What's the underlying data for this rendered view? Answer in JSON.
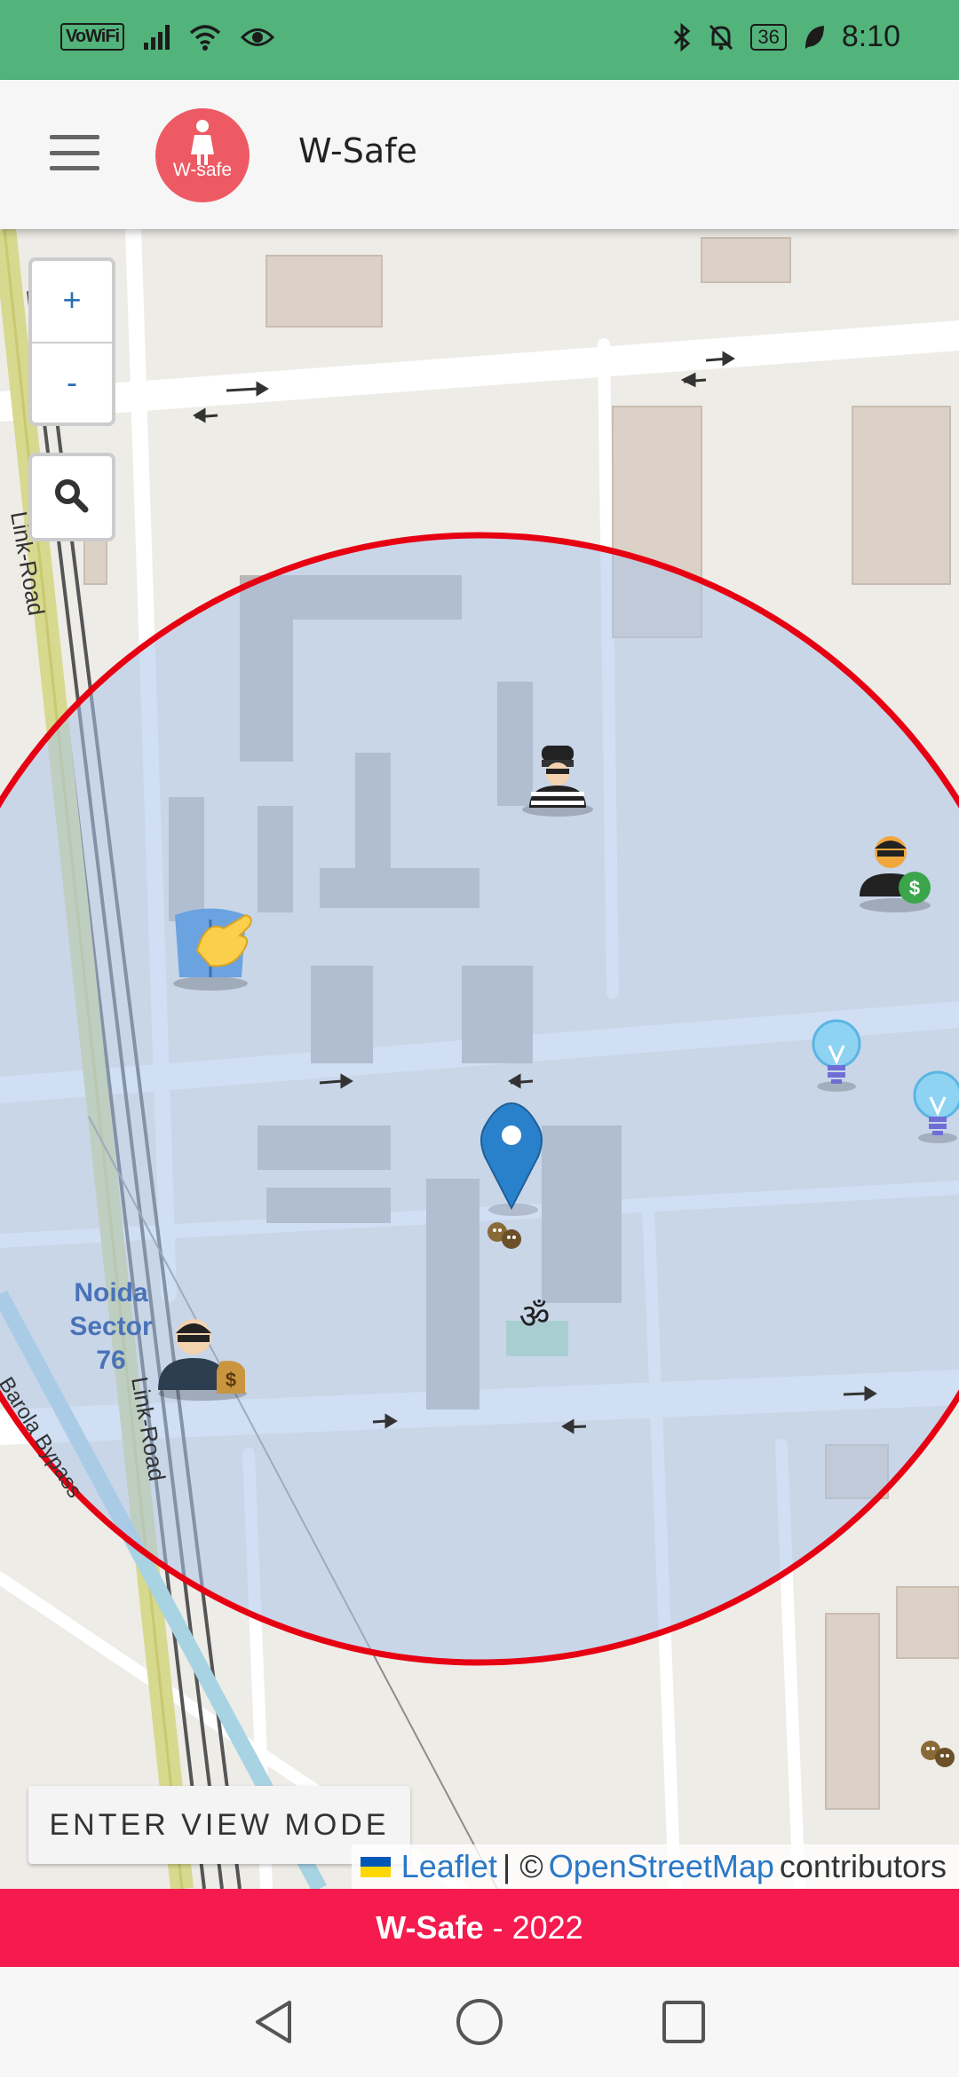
{
  "status_bar": {
    "vowifi": "VoWiFi",
    "battery": "36",
    "time": "8:10",
    "bluetooth_icon": "bluetooth-icon",
    "mute_icon": "bell-off-icon",
    "eye_icon": "eye-icon",
    "leaf_icon": "leaf-icon"
  },
  "header": {
    "title": "W-Safe",
    "logo_text": "W-safe"
  },
  "map": {
    "zoom_in": "+",
    "zoom_out": "-",
    "labels": {
      "area": [
        "Noida",
        "Sector",
        "76"
      ],
      "road1": "Link-Road",
      "road2": "Link-Road",
      "road3": "Barola Bypass"
    },
    "view_mode_button": "ENTER VIEW MODE",
    "attribution": {
      "leaflet": "Leaflet",
      "separator": "| ©",
      "osm": "OpenStreetMap",
      "contributors": "contributors"
    },
    "colors": {
      "circle_stroke": "#e60012",
      "circle_fill": "#a9c4ea",
      "marker": "#2a81cb"
    }
  },
  "footer": {
    "brand": "W-Safe",
    "separator": " - ",
    "year": "2022"
  },
  "nav": {
    "back_icon": "back-triangle-icon",
    "home_icon": "home-circle-icon",
    "recents_icon": "recents-square-icon"
  }
}
